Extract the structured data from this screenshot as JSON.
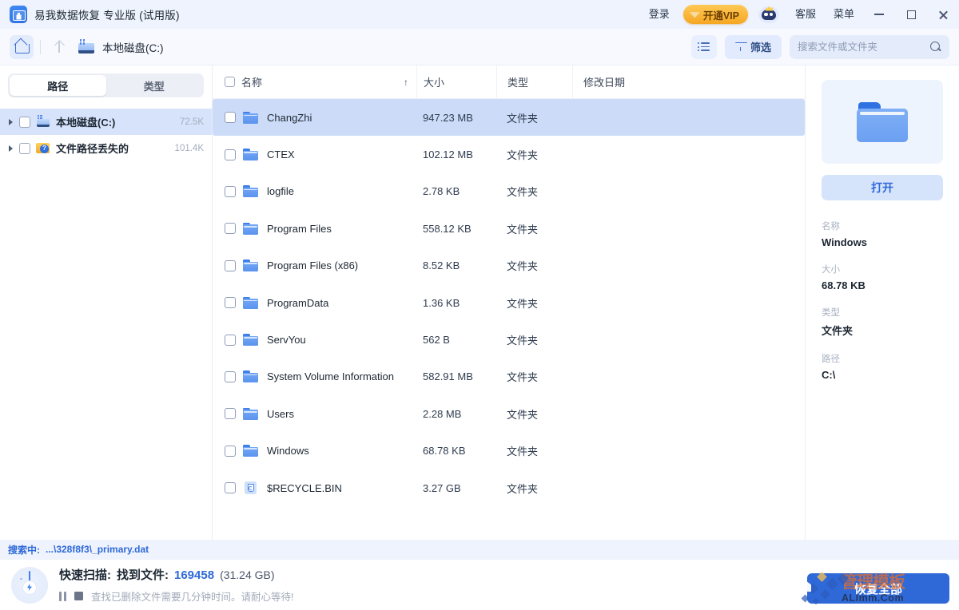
{
  "window": {
    "title": "易我数据恢复 专业版 (试用版)",
    "logo_icon": "toolbox-recovery-icon",
    "login_label": "登录",
    "vip_label": "开通VIP",
    "vip_icon": "diamond-icon",
    "mascot_icon": "mascot-robot-icon",
    "support_label": "客服",
    "menu_label": "菜单",
    "minimize_icon": "minimize-icon",
    "maximize_icon": "maximize-icon",
    "close_icon": "close-icon",
    "vip_color": "#f5a623",
    "titlebar_color": "#eef3fd"
  },
  "toolbar": {
    "home_icon": "home-icon",
    "up_icon": "arrow-up-icon",
    "drive_icon": "local-disk-icon",
    "breadcrumb": "本地磁盘(C:)",
    "view_icon": "list-view-icon",
    "filter_icon": "funnel-icon",
    "filter_label": "筛选",
    "search_placeholder": "搜索文件或文件夹",
    "search_value": "",
    "search_icon": "magnifier-icon"
  },
  "sidebar": {
    "tabs": [
      {
        "label": "路径",
        "active": true
      },
      {
        "label": "类型",
        "active": false
      }
    ],
    "tree": [
      {
        "label": "本地磁盘(C:)",
        "count": "72.5K",
        "icon": "local-disk-icon",
        "selected": true
      },
      {
        "label": "文件路径丢失的",
        "count": "101.4K",
        "icon": "lost-path-folder-icon",
        "selected": false
      }
    ]
  },
  "table": {
    "columns": [
      {
        "key": "name",
        "label": "名称",
        "sort": "↑"
      },
      {
        "key": "size",
        "label": "大小"
      },
      {
        "key": "type",
        "label": "类型"
      },
      {
        "key": "date",
        "label": "修改日期"
      }
    ],
    "rows": [
      {
        "name": "ChangZhi",
        "size": "947.23 MB",
        "type": "文件夹",
        "date": "",
        "icon": "folder-icon",
        "selected": true
      },
      {
        "name": "CTEX",
        "size": "102.12 MB",
        "type": "文件夹",
        "date": "",
        "icon": "folder-icon",
        "selected": false
      },
      {
        "name": "logfile",
        "size": "2.78 KB",
        "type": "文件夹",
        "date": "",
        "icon": "folder-icon",
        "selected": false
      },
      {
        "name": "Program Files",
        "size": "558.12 KB",
        "type": "文件夹",
        "date": "",
        "icon": "folder-icon",
        "selected": false
      },
      {
        "name": "Program Files (x86)",
        "size": "8.52 KB",
        "type": "文件夹",
        "date": "",
        "icon": "folder-icon",
        "selected": false
      },
      {
        "name": "ProgramData",
        "size": "1.36 KB",
        "type": "文件夹",
        "date": "",
        "icon": "folder-icon",
        "selected": false
      },
      {
        "name": "ServYou",
        "size": "562 B",
        "type": "文件夹",
        "date": "",
        "icon": "folder-icon",
        "selected": false
      },
      {
        "name": "System Volume Information",
        "size": "582.91 MB",
        "type": "文件夹",
        "date": "",
        "icon": "folder-icon",
        "selected": false
      },
      {
        "name": "Users",
        "size": "2.28 MB",
        "type": "文件夹",
        "date": "",
        "icon": "folder-icon",
        "selected": false
      },
      {
        "name": "Windows",
        "size": "68.78 KB",
        "type": "文件夹",
        "date": "",
        "icon": "folder-icon",
        "selected": false
      },
      {
        "name": "$RECYCLE.BIN",
        "size": "3.27 GB",
        "type": "文件夹",
        "date": "",
        "icon": "recycle-bin-icon",
        "selected": false
      }
    ]
  },
  "preview": {
    "thumb_icon": "folder-large-icon",
    "open_label": "打开",
    "fields": [
      {
        "key": "名称",
        "value": "Windows"
      },
      {
        "key": "大小",
        "value": "68.78 KB"
      },
      {
        "key": "类型",
        "value": "文件夹"
      },
      {
        "key": "路径",
        "value": "C:\\"
      }
    ]
  },
  "status": {
    "searching_label": "搜索中:",
    "searching_path": "...\\328f8f3\\_primary.dat",
    "scan_icon": "radar-scan-icon",
    "scan_mode": "快速扫描:",
    "found_label": "找到文件:",
    "found_count": "169458",
    "found_size": "(31.24 GB)",
    "pause_icon": "pause-icon",
    "stop_icon": "stop-icon",
    "hint": "查找已删除文件需要几分钟时间。请耐心等待!",
    "recover_label": "恢复全部",
    "accent_color": "#2f69d8"
  },
  "watermark": {
    "top_text": "管理模板",
    "bottom_text": "ALImm.Com"
  }
}
